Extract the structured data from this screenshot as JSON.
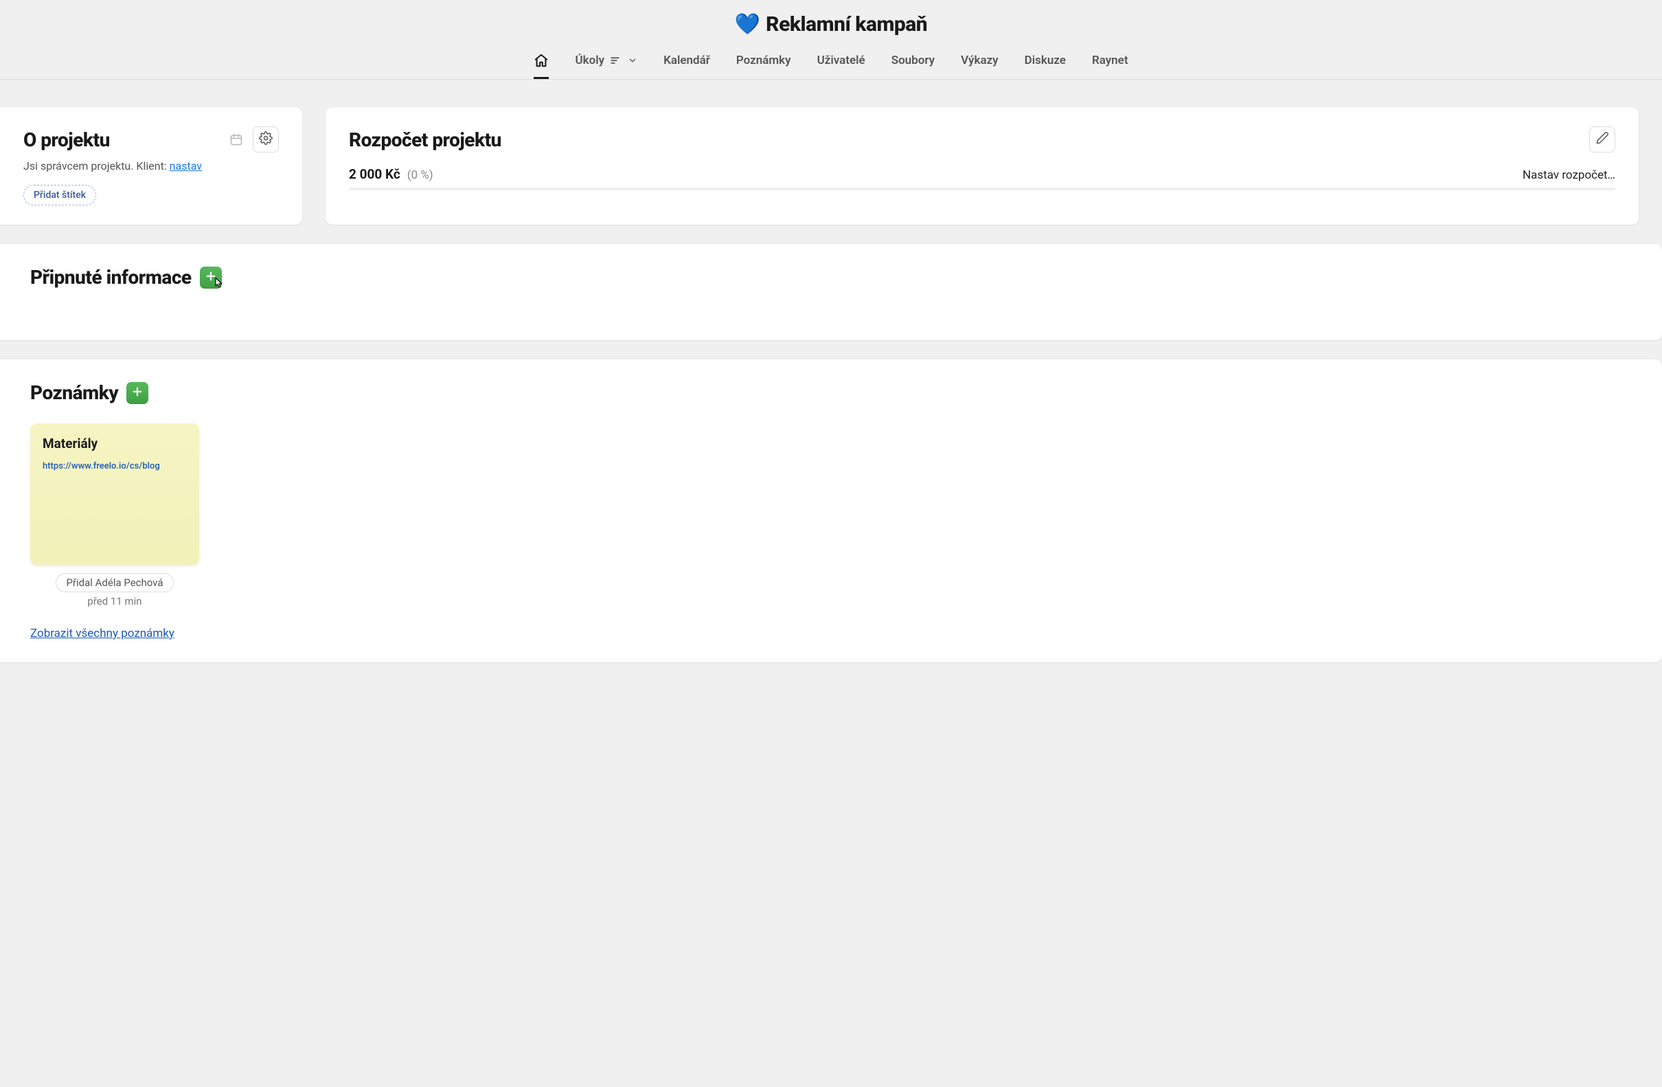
{
  "header": {
    "project_title": "Reklamní kampaň"
  },
  "tabs": {
    "ukoly": "Úkoly",
    "kalendar": "Kalendář",
    "poznamky": "Poznámky",
    "uzivatele": "Uživatelé",
    "soubory": "Soubory",
    "vykazy": "Výkazy",
    "diskuze": "Diskuze",
    "raynet": "Raynet"
  },
  "about": {
    "title": "O projektu",
    "subtitle_prefix": "Jsi správcem projektu. Klient: ",
    "client_link": "nastav",
    "add_tag": "Přidat štítek"
  },
  "budget": {
    "title": "Rozpočet projektu",
    "amount": "2 000 Kč",
    "percent": "(0 %)",
    "set_link": "Nastav rozpočet…"
  },
  "pinned": {
    "title": "Připnuté informace"
  },
  "notes": {
    "title": "Poznámky",
    "items": [
      {
        "title": "Materiály",
        "url": "https://www.freelo.io/cs/blog",
        "author": "Přidal Adéla Pechová",
        "time": "před 11 min"
      }
    ],
    "show_all": "Zobrazit všechny poznámky"
  }
}
